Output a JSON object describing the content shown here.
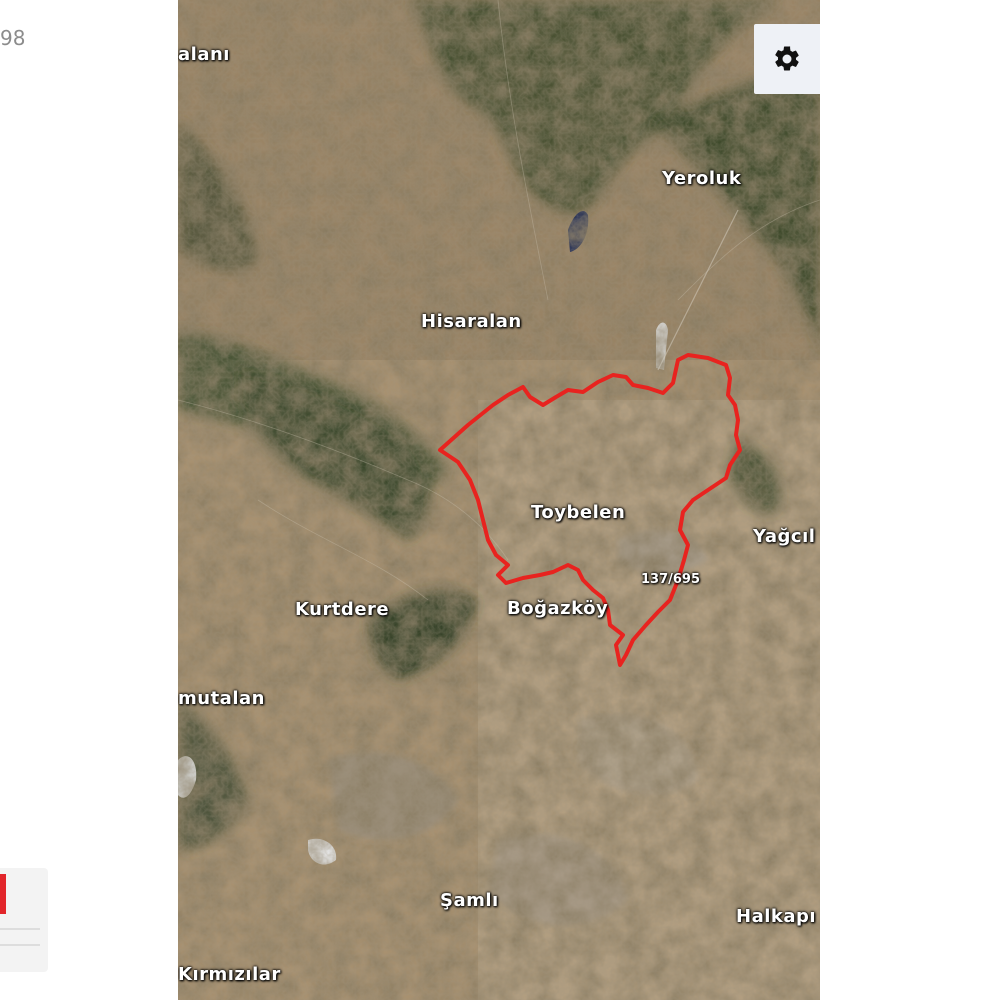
{
  "left_panel": {
    "number": "98"
  },
  "map": {
    "type": "satellite",
    "settings_icon": "gear-icon",
    "boundary_color": "#e8231f",
    "labels": {
      "alani": "alanı",
      "yeroluk": "Yeroluk",
      "hisaralan": "Hisaralan",
      "toybelen": "Toybelen",
      "yagcil": "Yağcıl",
      "elevation": "137/695",
      "kurtdere": "Kurtdere",
      "bogazkoy": "Boğazköy",
      "mutalan": "mutalan",
      "samli": "Şamlı",
      "halkapinar": "Halkapı",
      "kirmizilar": "Kırmızılar"
    }
  }
}
